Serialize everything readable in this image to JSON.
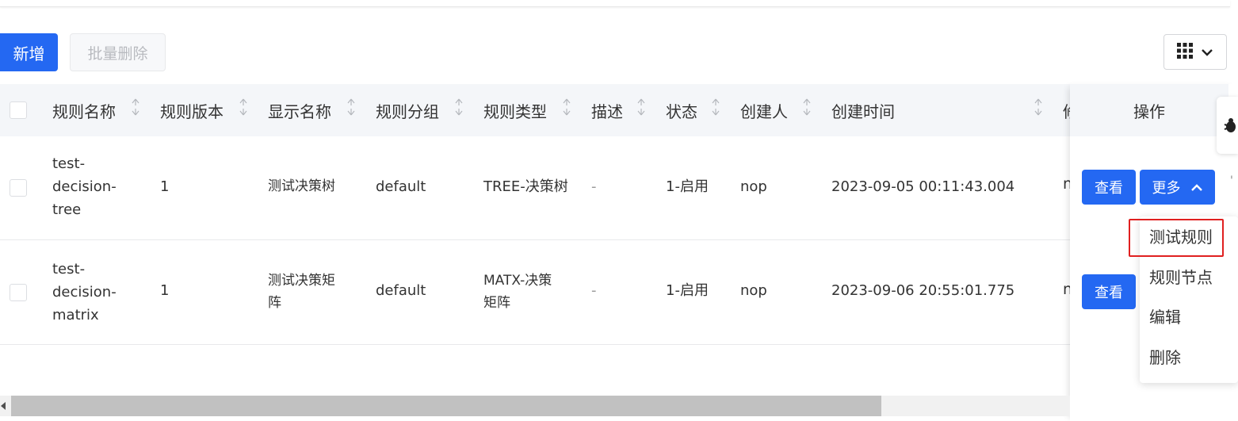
{
  "toolbar": {
    "add_label": "新增",
    "batch_delete_label": "批量删除"
  },
  "columns": [
    "规则名称",
    "规则版本",
    "显示名称",
    "规则分组",
    "规则类型",
    "描述",
    "状态",
    "创建人",
    "创建时间"
  ],
  "partial_column_glyph": "修",
  "operations_header": "操作",
  "rows": [
    {
      "rule_name": [
        "test-",
        "decision-",
        "tree"
      ],
      "version": "1",
      "display_name": [
        "测试决策树"
      ],
      "group": "default",
      "type": [
        "TREE-决策树"
      ],
      "description": "-",
      "status": "1-启用",
      "creator": "nop",
      "created_at": "2023-09-05 00:11:43.004",
      "partial_next": "n"
    },
    {
      "rule_name": [
        "test-",
        "decision-",
        "matrix"
      ],
      "version": "1",
      "display_name": [
        "测试决策矩",
        "阵"
      ],
      "group": "default",
      "type": [
        "MATX-决策",
        "矩阵"
      ],
      "description": "-",
      "status": "1-启用",
      "creator": "nop",
      "created_at": "2023-09-06 20:55:01.775",
      "partial_next": "n"
    }
  ],
  "actions": {
    "view_label": "查看",
    "more_label": "更多"
  },
  "dropdown_items": [
    "测试规则",
    "规则节点",
    "编辑",
    "删除"
  ],
  "colors": {
    "primary": "#2468f2",
    "highlight": "#e02020",
    "header_bg": "#f4f6f9"
  },
  "icons": {
    "columns_toggle": "grid-icon",
    "chevron": "chevron-down-icon",
    "more_chevron": "chevron-up-icon",
    "sort": "sort-icon",
    "side_tab": "bug-icon"
  }
}
